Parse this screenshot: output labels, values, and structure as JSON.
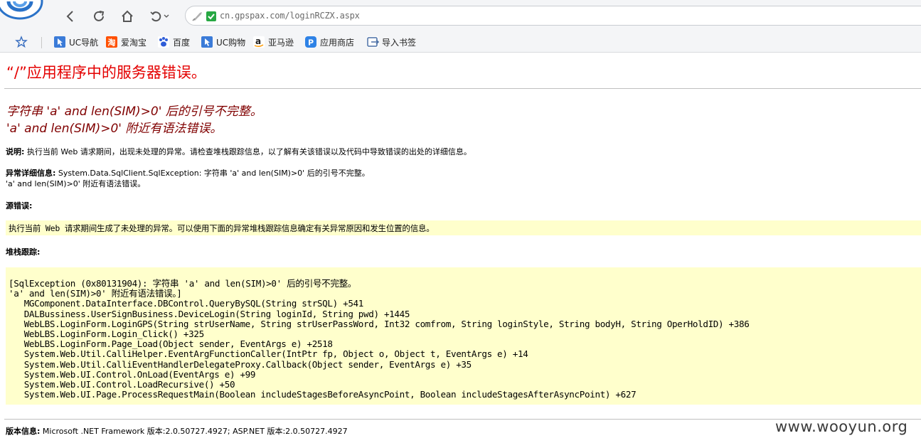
{
  "browser": {
    "url": "cn.gpspax.com/loginRCZX.aspx",
    "nav_icons": [
      "back-icon",
      "reload-icon",
      "home-icon",
      "undo-icon",
      "chevron-down-icon"
    ],
    "bookmarks": [
      {
        "label": "UC导航",
        "icon": "uc-nav-icon",
        "color": "#3b7bd8"
      },
      {
        "label": "爱淘宝",
        "icon": "taobao-icon",
        "color": "#ff5000"
      },
      {
        "label": "百度",
        "icon": "baidu-icon",
        "color": "#2f5dd8"
      },
      {
        "label": "UC购物",
        "icon": "uc-shop-icon",
        "color": "#3b7bd8"
      },
      {
        "label": "亚马逊",
        "icon": "amazon-icon",
        "color": "#222222"
      },
      {
        "label": "应用商店",
        "icon": "app-store-icon",
        "color": "#2e82e6"
      },
      {
        "label": "导入书签",
        "icon": "import-bookmarks-icon",
        "color": "#4a6fa5"
      }
    ]
  },
  "page": {
    "title": "“/”应用程序中的服务器错误。",
    "error_line1": "字符串 'a' and len(SIM)>0' 后的引号不完整。",
    "error_line2": "'a' and len(SIM)>0' 附近有语法错误。",
    "description_label": "说明:",
    "description_text": " 执行当前 Web 请求期间，出现未处理的异常。请检查堆栈跟踪信息，以了解有关该错误以及代码中导致错误的出处的详细信息。",
    "exception_label": "异常详细信息:",
    "exception_text": " System.Data.SqlClient.SqlException: 字符串 'a' and len(SIM)>0' 后的引号不完整。",
    "exception_text2": "'a' and len(SIM)>0' 附近有语法错误。",
    "source_label": "源错误:",
    "source_text": "执行当前 Web 请求期间生成了未处理的异常。可以使用下面的异常堆栈跟踪信息确定有关异常原因和发生位置的信息。",
    "stack_label": "堆栈跟踪:",
    "stack_trace": "[SqlException (0x80131904): 字符串 'a' and len(SIM)>0' 后的引号不完整。\n'a' and len(SIM)>0' 附近有语法错误。]\n   MGComponent.DataInterface.DBControl.QueryBySQL(String strSQL) +541\n   DALBussiness.UserSignBusiness.DeviceLogin(String loginId, String pwd) +1445\n   WebLBS.LoginForm.LoginGPS(String strUserName, String strUserPassWord, Int32 comfrom, String loginStyle, String bodyH, String OperHoldID) +386\n   WebLBS.LoginForm.Login_Click() +325\n   WebLBS.LoginForm.Page_Load(Object sender, EventArgs e) +2518\n   System.Web.Util.CalliHelper.EventArgFunctionCaller(IntPtr fp, Object o, Object t, EventArgs e) +14\n   System.Web.Util.CalliEventHandlerDelegateProxy.Callback(Object sender, EventArgs e) +35\n   System.Web.UI.Control.OnLoad(EventArgs e) +99\n   System.Web.UI.Control.LoadRecursive() +50\n   System.Web.UI.Page.ProcessRequestMain(Boolean includeStagesBeforeAsyncPoint, Boolean includeStagesAfterAsyncPoint) +627",
    "version_label": "版本信息:",
    "version_text": " Microsoft .NET Framework 版本:2.0.50727.4927; ASP.NET 版本:2.0.50727.4927"
  },
  "watermark": "www.wooyun.org",
  "colors": {
    "title": "#e40000",
    "error_message": "#800000",
    "highlight_box": "#ffffcc"
  }
}
